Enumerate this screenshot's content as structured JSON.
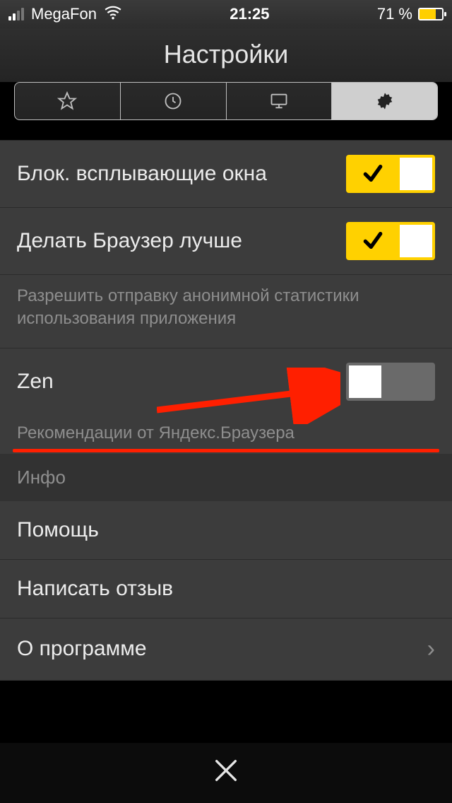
{
  "status_bar": {
    "carrier": "MegaFon",
    "time": "21:25",
    "battery_percent": "71 %"
  },
  "header": {
    "title": "Настройки"
  },
  "tabs": {
    "items": [
      "favorites",
      "history",
      "desktop",
      "settings"
    ],
    "active_index": 3
  },
  "settings": {
    "block_popups": {
      "label": "Блок. всплывающие окна",
      "value": true
    },
    "improve_browser": {
      "label": "Делать Браузер лучше",
      "value": true
    },
    "improve_browser_desc": "Разрешить отправку анонимной статистики использования приложения",
    "zen": {
      "label": "Zen",
      "value": false
    },
    "zen_desc": "Рекомендации от Яндекс.Браузера"
  },
  "info_section": {
    "header": "Инфо",
    "items": [
      {
        "label": "Помощь"
      },
      {
        "label": "Написать отзыв"
      },
      {
        "label": "О программе"
      }
    ]
  },
  "colors": {
    "accent": "#ffd100",
    "annotation": "#ff1f00"
  }
}
